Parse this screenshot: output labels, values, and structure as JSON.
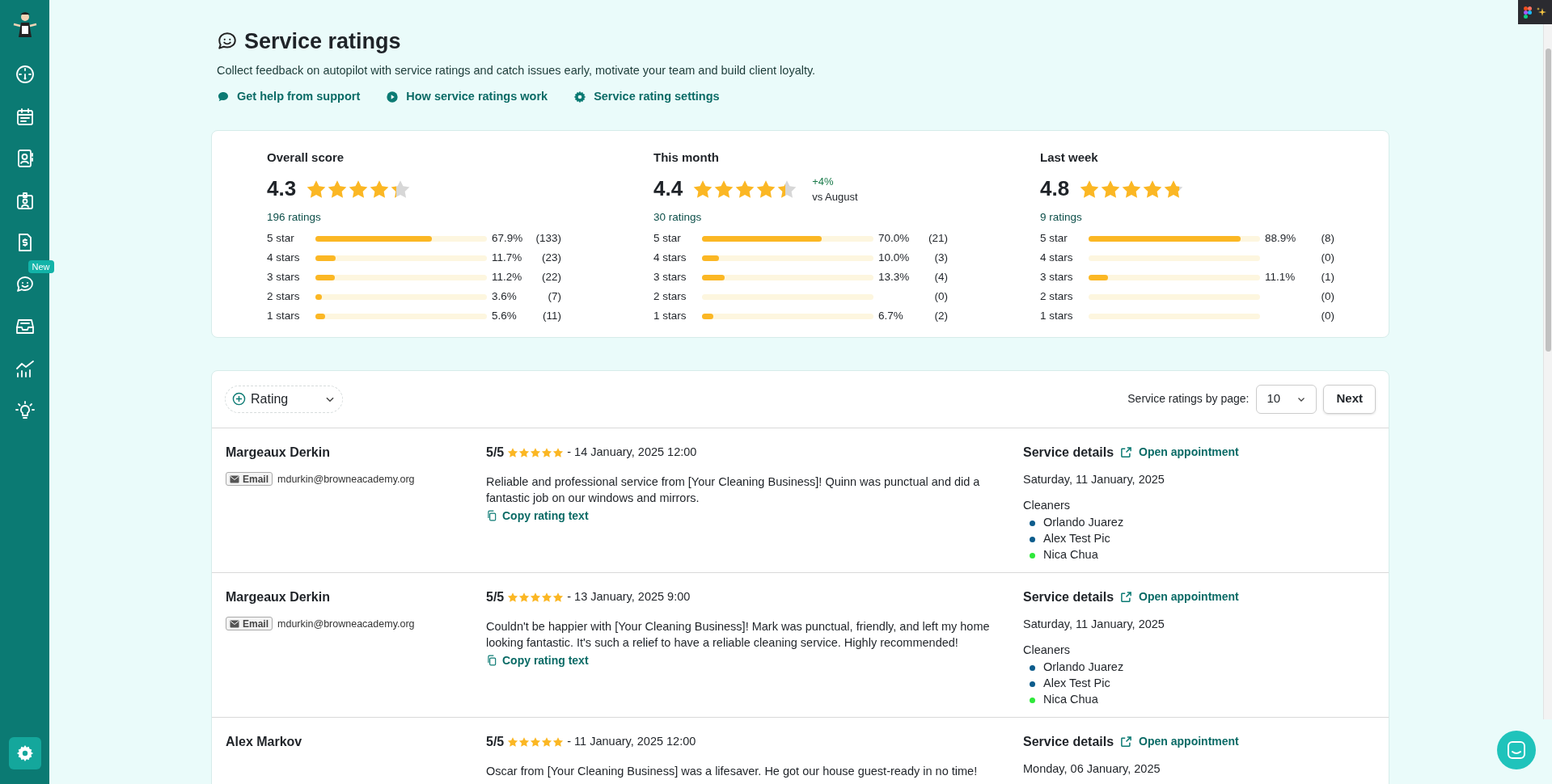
{
  "sidebar": {
    "items": [
      {
        "kind": "gauge"
      },
      {
        "kind": "calendar"
      },
      {
        "kind": "contacts"
      },
      {
        "kind": "badge"
      },
      {
        "kind": "invoice"
      },
      {
        "kind": "chat",
        "badge": "New"
      },
      {
        "kind": "inbox"
      },
      {
        "kind": "chart"
      },
      {
        "kind": "idea"
      }
    ]
  },
  "header": {
    "title": "Service ratings",
    "description": "Collect feedback on autopilot with service ratings and catch issues early, motivate your team and build client loyalty.",
    "links": [
      {
        "kind": "support",
        "label": "Get help from support"
      },
      {
        "kind": "play",
        "label": "How service ratings work"
      },
      {
        "kind": "settings",
        "label": "Service rating settings"
      }
    ]
  },
  "summary": [
    {
      "title": "Overall score",
      "score": "4.3",
      "stars": 4.3,
      "ratings": "196 ratings",
      "breakdown": [
        {
          "label": "5 star",
          "level": 0.679,
          "percent": "67.9%",
          "count": "(133)"
        },
        {
          "label": "4 stars",
          "level": 0.117,
          "percent": "11.7%",
          "count": "(23)"
        },
        {
          "label": "3 stars",
          "level": 0.112,
          "percent": "11.2%",
          "count": "(22)"
        },
        {
          "label": "2 stars",
          "level": 0.036,
          "percent": "3.6%",
          "count": "(7)"
        },
        {
          "label": "1 stars",
          "level": 0.056,
          "percent": "5.6%",
          "count": "(11)"
        }
      ]
    },
    {
      "title": "This month",
      "score": "4.4",
      "stars": 4.4,
      "change": "+4%",
      "change_note": "vs August",
      "ratings": "30 ratings",
      "breakdown": [
        {
          "label": "5 star",
          "level": 0.7,
          "percent": "70.0%",
          "count": "(21)"
        },
        {
          "label": "4 stars",
          "level": 0.1,
          "percent": "10.0%",
          "count": "(3)"
        },
        {
          "label": "3 stars",
          "level": 0.133,
          "percent": "13.3%",
          "count": "(4)"
        },
        {
          "label": "2 stars",
          "level": 0,
          "count": "(0)"
        },
        {
          "label": "1 stars",
          "level": 0.067,
          "percent": "6.7%",
          "count": "(2)"
        }
      ]
    },
    {
      "title": "Last week",
      "score": "4.8",
      "stars": 4.8,
      "ratings": "9 ratings",
      "breakdown": [
        {
          "label": "5 star",
          "level": 0.889,
          "percent": "88.9%",
          "count": "(8)"
        },
        {
          "label": "4 stars",
          "level": 0,
          "count": "(0)"
        },
        {
          "label": "3 stars",
          "level": 0.111,
          "percent": "11.1%",
          "count": "(1)"
        },
        {
          "label": "2 stars",
          "level": 0,
          "count": "(0)"
        },
        {
          "label": "1 stars",
          "level": 0,
          "count": "(0)"
        }
      ]
    }
  ],
  "toolbar": {
    "filter": "Rating",
    "page_size_label": "Service ratings by page:",
    "page_size": "10",
    "next": "Next"
  },
  "ratings": [
    {
      "name": "Margeaux Derkin",
      "contact_type": "Email",
      "contact": "mdurkin@browneacademy.org",
      "score": "5/5",
      "stars": 5,
      "date": "- 14 January, 2025 12:00",
      "text": "Reliable and professional service from [Your Cleaning Business]! Quinn was punctual and did a fantastic job on our windows and mirrors.",
      "copy": "Copy rating text",
      "details_title": "Service details",
      "open": "Open appointment",
      "service_date": "Saturday, 11 January, 2025",
      "cleaners_label": "Cleaners",
      "cleaners": [
        {
          "name": "Orlando Juarez",
          "color": "#0d5c8c"
        },
        {
          "name": "Alex Test Pic",
          "color": "#0d5c8c"
        },
        {
          "name": "Nica Chua",
          "color": "#2ee83a"
        }
      ]
    },
    {
      "name": "Margeaux Derkin",
      "contact_type": "Email",
      "contact": "mdurkin@browneacademy.org",
      "score": "5/5",
      "stars": 5,
      "date": "- 13 January, 2025 9:00",
      "text": "Couldn't be happier with [Your Cleaning Business]! Mark was punctual, friendly, and left my home looking fantastic. It's such a relief to have a reliable cleaning service. Highly recommended!",
      "copy": "Copy rating text",
      "details_title": "Service details",
      "open": "Open appointment",
      "service_date": "Saturday, 11 January, 2025",
      "cleaners_label": "Cleaners",
      "cleaners": [
        {
          "name": "Orlando Juarez",
          "color": "#0d5c8c"
        },
        {
          "name": "Alex Test Pic",
          "color": "#0d5c8c"
        },
        {
          "name": "Nica Chua",
          "color": "#2ee83a"
        }
      ]
    },
    {
      "name": "Alex Markov",
      "score": "5/5",
      "stars": 5,
      "date": "- 11 January, 2025 12:00",
      "text": "Oscar from [Your Cleaning Business] was a lifesaver. He got our house guest-ready in no time!",
      "details_title": "Service details",
      "open": "Open appointment",
      "service_date": "Monday, 06 January, 2025"
    }
  ]
}
